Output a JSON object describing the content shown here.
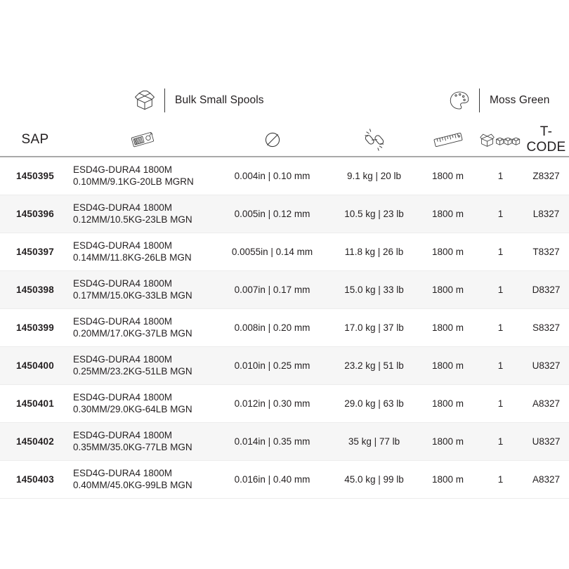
{
  "attributes": [
    {
      "icon": "open-box-icon",
      "label": "Bulk Small Spools"
    },
    {
      "icon": "paint-palette-icon",
      "label": "Moss Green"
    }
  ],
  "table": {
    "columns": [
      {
        "key": "sap",
        "type": "text",
        "label": "SAP",
        "icon": null
      },
      {
        "key": "desc",
        "type": "icon",
        "label": "",
        "icon": "price-tag-barcode-icon"
      },
      {
        "key": "dia",
        "type": "icon",
        "label": "",
        "icon": "diameter-icon"
      },
      {
        "key": "str",
        "type": "icon",
        "label": "",
        "icon": "chain-link-strength-icon"
      },
      {
        "key": "len",
        "type": "icon",
        "label": "",
        "icon": "ruler-icon"
      },
      {
        "key": "units",
        "type": "icon",
        "label": "",
        "icon": "box-units-icon"
      },
      {
        "key": "tcode",
        "type": "text",
        "label": "T-CODE",
        "icon": null
      }
    ],
    "rows": [
      {
        "sap": "1450395",
        "desc_line1": "ESD4G-DURA4 1800M",
        "desc_line2": "0.10MM/9.1KG-20LB MGRN",
        "dia": "0.004in | 0.10 mm",
        "str": "9.1 kg | 20 lb",
        "len": "1800 m",
        "units": "1",
        "tcode": "Z8327"
      },
      {
        "sap": "1450396",
        "desc_line1": "ESD4G-DURA4 1800M",
        "desc_line2": "0.12MM/10.5KG-23LB MGN",
        "dia": "0.005in | 0.12 mm",
        "str": "10.5 kg | 23 lb",
        "len": "1800 m",
        "units": "1",
        "tcode": "L8327"
      },
      {
        "sap": "1450397",
        "desc_line1": "ESD4G-DURA4 1800M",
        "desc_line2": "0.14MM/11.8KG-26LB MGN",
        "dia": "0.0055in | 0.14 mm",
        "str": "11.8 kg | 26 lb",
        "len": "1800 m",
        "units": "1",
        "tcode": "T8327"
      },
      {
        "sap": "1450398",
        "desc_line1": "ESD4G-DURA4 1800M",
        "desc_line2": "0.17MM/15.0KG-33LB MGN",
        "dia": "0.007in | 0.17 mm",
        "str": "15.0 kg | 33 lb",
        "len": "1800 m",
        "units": "1",
        "tcode": "D8327"
      },
      {
        "sap": "1450399",
        "desc_line1": "ESD4G-DURA4 1800M",
        "desc_line2": "0.20MM/17.0KG-37LB MGN",
        "dia": "0.008in | 0.20 mm",
        "str": "17.0 kg | 37 lb",
        "len": "1800 m",
        "units": "1",
        "tcode": "S8327"
      },
      {
        "sap": "1450400",
        "desc_line1": "ESD4G-DURA4 1800M",
        "desc_line2": "0.25MM/23.2KG-51LB MGN",
        "dia": "0.010in | 0.25 mm",
        "str": "23.2 kg | 51 lb",
        "len": "1800 m",
        "units": "1",
        "tcode": "U8327"
      },
      {
        "sap": "1450401",
        "desc_line1": "ESD4G-DURA4 1800M",
        "desc_line2": "0.30MM/29.0KG-64LB MGN",
        "dia": "0.012in | 0.30 mm",
        "str": "29.0 kg | 63 lb",
        "len": "1800 m",
        "units": "1",
        "tcode": "A8327"
      },
      {
        "sap": "1450402",
        "desc_line1": "ESD4G-DURA4 1800M",
        "desc_line2": "0.35MM/35.0KG-77LB MGN",
        "dia": "0.014in | 0.35 mm",
        "str": "35 kg | 77 lb",
        "len": "1800 m",
        "units": "1",
        "tcode": "U8327"
      },
      {
        "sap": "1450403",
        "desc_line1": "ESD4G-DURA4 1800M",
        "desc_line2": "0.40MM/45.0KG-99LB MGN",
        "dia": "0.016in | 0.40 mm",
        "str": "45.0 kg | 99 lb",
        "len": "1800 m",
        "units": "1",
        "tcode": "A8327"
      }
    ]
  },
  "colors": {
    "text": "#231f20",
    "stripe": "#f6f6f6",
    "header_rule": "#a9a9a9",
    "row_rule": "#ececec",
    "icon_stroke": "#3b3b3b"
  }
}
